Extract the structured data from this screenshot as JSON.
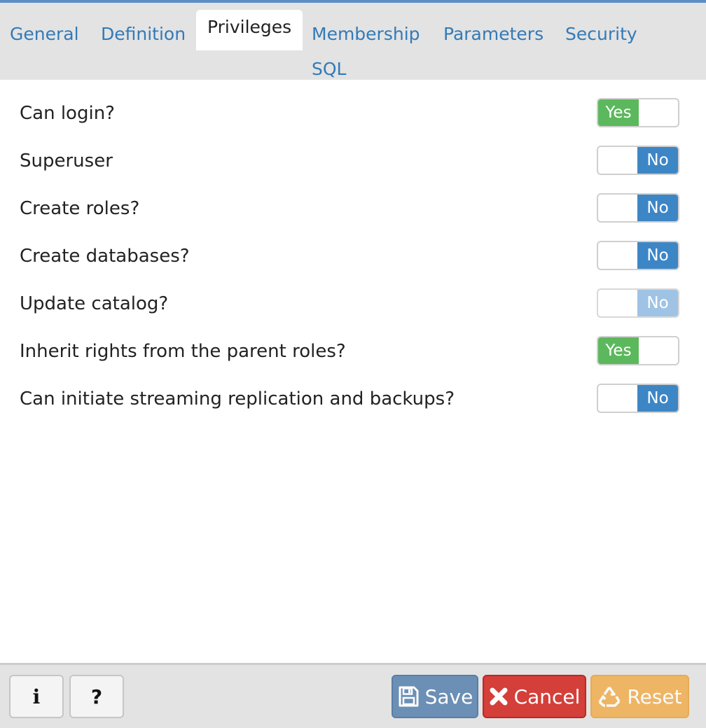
{
  "tabs": {
    "general": "General",
    "definition": "Definition",
    "privileges": "Privileges",
    "membership": "Membership",
    "parameters": "Parameters",
    "security": "Security",
    "sql": "SQL",
    "active": "privileges"
  },
  "privileges": [
    {
      "label": "Can login?",
      "state": "Yes",
      "enabled": true
    },
    {
      "label": "Superuser",
      "state": "No",
      "enabled": true
    },
    {
      "label": "Create roles?",
      "state": "No",
      "enabled": true
    },
    {
      "label": "Create databases?",
      "state": "No",
      "enabled": true
    },
    {
      "label": "Update catalog?",
      "state": "No",
      "enabled": false
    },
    {
      "label": "Inherit rights from the parent roles?",
      "state": "Yes",
      "enabled": true
    },
    {
      "label": "Can initiate streaming replication and backups?",
      "state": "No",
      "enabled": true
    }
  ],
  "footer": {
    "info_label": "i",
    "help_label": "?",
    "save_label": "Save",
    "cancel_label": "Cancel",
    "reset_label": "Reset",
    "save_icon": "floppy-disk-icon",
    "cancel_icon": "close-icon",
    "reset_icon": "recycle-icon"
  },
  "colors": {
    "link": "#337ab7",
    "toggle_on": "#5cb85c",
    "toggle_off": "#3d86c6",
    "save": "#6b8fb5",
    "cancel": "#d43f3a",
    "reset": "#f0ad4e"
  }
}
